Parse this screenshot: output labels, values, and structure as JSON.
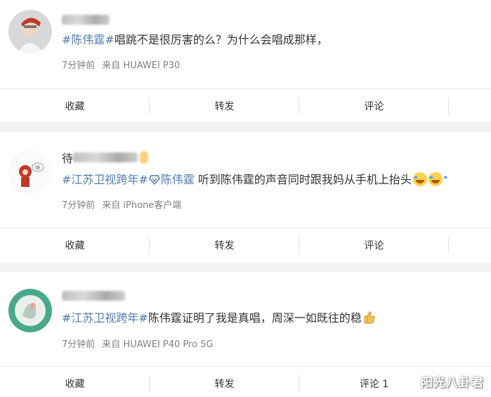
{
  "posts": [
    {
      "username_hidden": "",
      "topics": [
        "#陈伟霆#"
      ],
      "text": "唱跳不是很厉害的么？为什么会唱成那样，",
      "time": "7分钟前",
      "source": "来自 HUAWEI P30"
    },
    {
      "username_char": "待",
      "topics": [
        "#江苏卫视跨年#",
        "陈伟霆"
      ],
      "text": " 听到陈伟霆的声音同时跟我妈从手机上抬头",
      "time": "7分钟前",
      "source": "来自 iPhone客户端"
    },
    {
      "username_char": "",
      "topics": [
        "#江苏卫视跨年#"
      ],
      "text": "陈伟霆证明了我是真唱，周深一如既往的稳",
      "time": "7分钟前",
      "source": "来自 HUAWEI P40 Pro 5G"
    }
  ],
  "actions": {
    "favorite": "收藏",
    "repost": "转发",
    "comment": "评论",
    "comment_with_count": "评论 1"
  },
  "watermark": "阳光八卦君",
  "colors": {
    "topic": "#507daf",
    "meta": "#808080",
    "background": "#f2f2f2"
  }
}
